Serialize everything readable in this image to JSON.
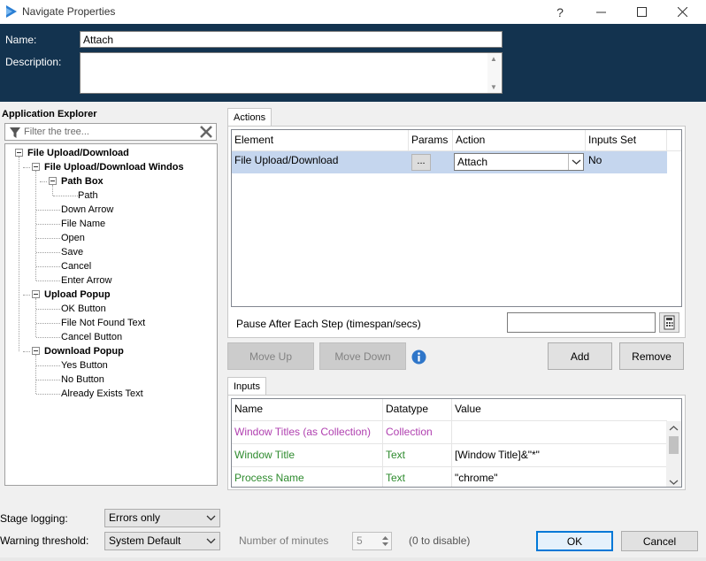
{
  "window": {
    "title": "Navigate Properties",
    "help_label": "?"
  },
  "header": {
    "name_label": "Name:",
    "name_value": "Attach",
    "description_label": "Description:",
    "description_value": ""
  },
  "explorer": {
    "title": "Application Explorer",
    "filter_placeholder": "Filter the tree...",
    "items": [
      {
        "label": "File Upload/Download",
        "bold": true
      },
      {
        "label": "File Upload/Download Windos",
        "bold": true
      },
      {
        "label": "Path Box",
        "bold": true
      },
      {
        "label": "Path",
        "bold": false
      },
      {
        "label": "Down Arrow",
        "bold": false
      },
      {
        "label": "File Name",
        "bold": false
      },
      {
        "label": "Open",
        "bold": false
      },
      {
        "label": "Save",
        "bold": false
      },
      {
        "label": "Cancel",
        "bold": false
      },
      {
        "label": "Enter Arrow",
        "bold": false
      },
      {
        "label": "Upload Popup",
        "bold": true
      },
      {
        "label": "OK Button",
        "bold": false
      },
      {
        "label": "File Not Found Text",
        "bold": false
      },
      {
        "label": "Cancel Button",
        "bold": false
      },
      {
        "label": "Download Popup",
        "bold": true
      },
      {
        "label": "Yes Button",
        "bold": false
      },
      {
        "label": "No Button",
        "bold": false
      },
      {
        "label": "Already Exists Text",
        "bold": false
      }
    ]
  },
  "actions": {
    "tab_label": "Actions",
    "columns": [
      "Element",
      "Params",
      "Action",
      "Inputs Set"
    ],
    "row": {
      "element": "File Upload/Download",
      "params": "...",
      "action": "Attach",
      "inputs_set": "No"
    },
    "pause_label": "Pause After Each Step (timespan/secs)",
    "pause_value": "",
    "move_up_label": "Move Up",
    "move_down_label": "Move Down",
    "add_label": "Add",
    "remove_label": "Remove"
  },
  "inputs": {
    "tab_label": "Inputs",
    "columns": [
      "Name",
      "Datatype",
      "Value"
    ],
    "rows": [
      {
        "name": "Window Titles (as Collection)",
        "datatype": "Collection",
        "value": "",
        "color": "#b040b0"
      },
      {
        "name": "Window Title",
        "datatype": "Text",
        "value": "[Window Title]&\"*\"",
        "color": "#2e8b2e"
      },
      {
        "name": "Process Name",
        "datatype": "Text",
        "value": "\"chrome\"",
        "color": "#2e8b2e"
      }
    ]
  },
  "footer": {
    "stage_logging_label": "Stage logging:",
    "stage_logging_value": "Errors only",
    "warning_label": "Warning threshold:",
    "warning_value": "System Default",
    "minutes_label": "Number of minutes",
    "minutes_value": "5",
    "disable_hint": "(0 to disable)",
    "ok_label": "OK",
    "cancel_label": "Cancel"
  },
  "colors": {
    "header_bg": "#13334f",
    "selection": "#c5d6ee",
    "accent": "#0078d7"
  }
}
